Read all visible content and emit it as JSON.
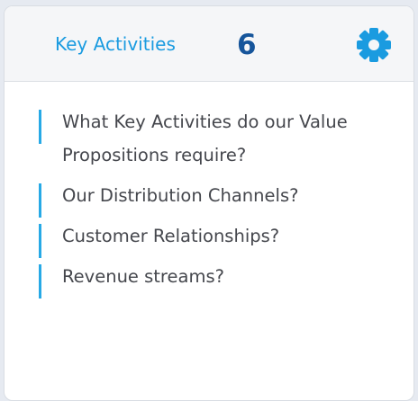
{
  "card": {
    "title": "Key Activities",
    "count": "6",
    "settings_icon": "gear-icon",
    "accent_color": "#1a9be0",
    "count_color": "#16559b"
  },
  "questions": [
    {
      "text": "What Key Activities do our Value Propositions require?"
    },
    {
      "text": "Our Distribution Channels?"
    },
    {
      "text": "Customer Relationships?"
    },
    {
      "text": "Revenue streams?"
    }
  ]
}
